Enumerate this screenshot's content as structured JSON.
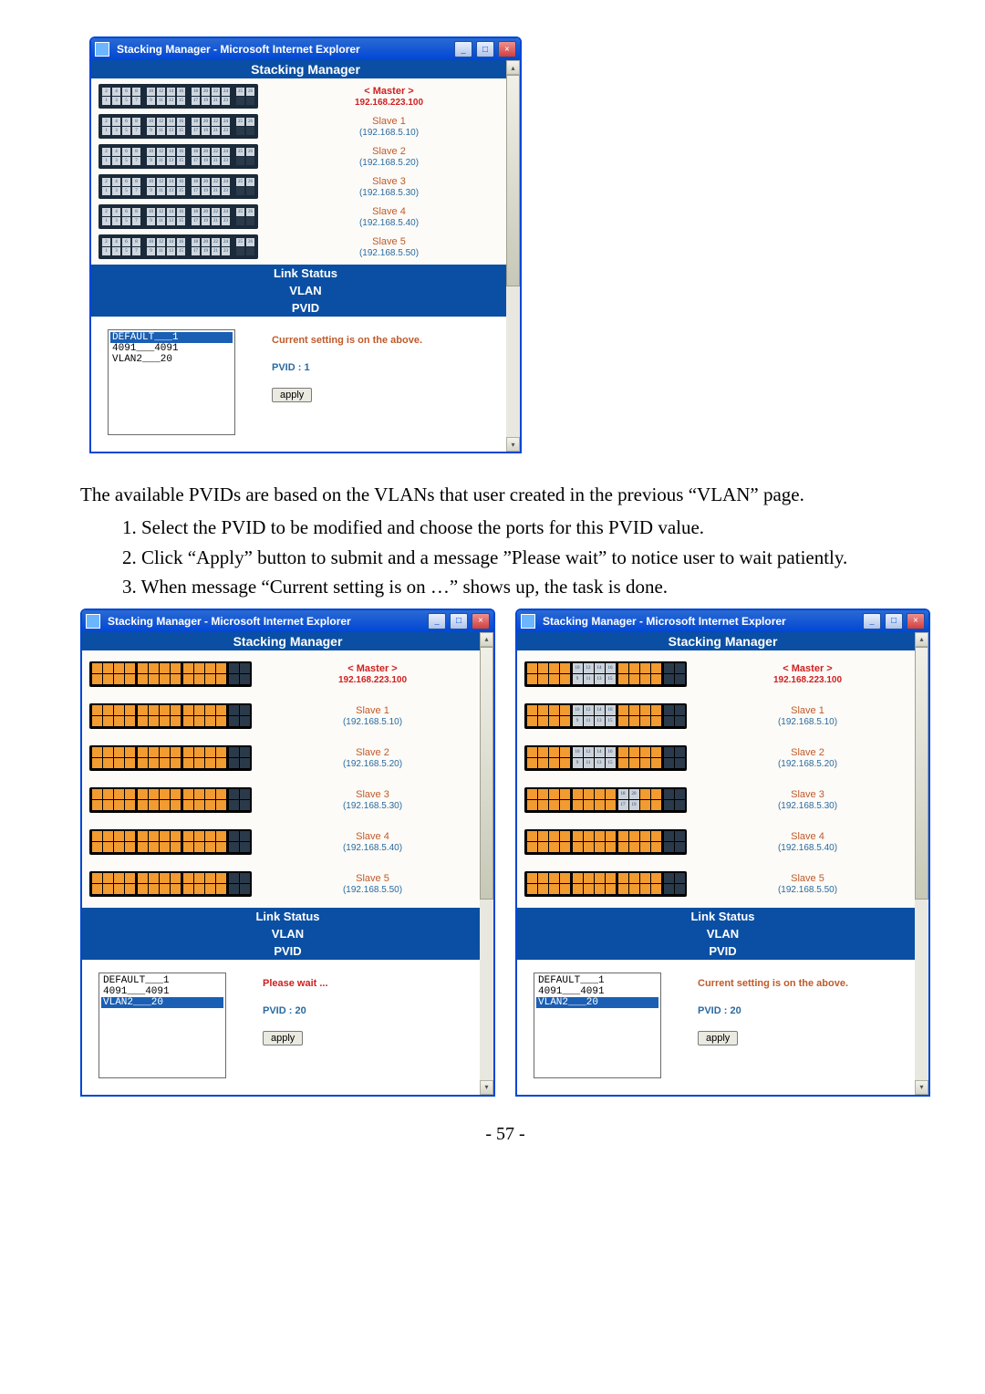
{
  "window_title": "Stacking Manager - Microsoft Internet Explorer",
  "headers": {
    "stacking": "Stacking Manager",
    "link": "Link Status",
    "vlan": "VLAN",
    "pvid": "PVID"
  },
  "switches": [
    {
      "name": "< Master >",
      "ip": "192.168.223.100",
      "master": true
    },
    {
      "name": "Slave 1",
      "ip": "(192.168.5.10)",
      "master": false
    },
    {
      "name": "Slave 2",
      "ip": "(192.168.5.20)",
      "master": false
    },
    {
      "name": "Slave 3",
      "ip": "(192.168.5.30)",
      "master": false
    },
    {
      "name": "Slave 4",
      "ip": "(192.168.5.40)",
      "master": false
    },
    {
      "name": "Slave 5",
      "ip": "(192.168.5.50)",
      "master": false
    }
  ],
  "vlan_list": {
    "items": [
      {
        "label": "DEFAULT___1",
        "sel": true
      },
      {
        "label": "4091___4091",
        "sel": false
      },
      {
        "label": "VLAN2___20",
        "sel": false
      }
    ]
  },
  "status": {
    "current": "Current setting is on the above.",
    "wait": "Please wait ..."
  },
  "pvid": {
    "labels": {
      "one": "PVID : 1",
      "twenty": "PVID : 20"
    },
    "apply": "apply"
  },
  "text": {
    "intro": "The available PVIDs are based on the VLANs that user created in the previous “VLAN” page.",
    "s1": "1. Select the PVID to be modified and choose the ports for this PVID value.",
    "s2": "2. Click “Apply” button to submit and a message ”Please wait” to notice user to wait patiently.",
    "s3": "3. When message “Current setting is on …” shows up, the task is done."
  },
  "bottom_left": {
    "vlan_list": [
      {
        "label": "DEFAULT___1",
        "sel": false
      },
      {
        "label": "4091___4091",
        "sel": false
      },
      {
        "label": "VLAN2___20",
        "sel": true
      }
    ],
    "status": "Please wait ...",
    "pvid": "PVID : 20"
  },
  "bottom_right": {
    "vlan_list": [
      {
        "label": "DEFAULT___1",
        "sel": false
      },
      {
        "label": "4091___4091",
        "sel": false
      },
      {
        "label": "VLAN2___20",
        "sel": true
      }
    ],
    "status": "Current setting is on the above.",
    "pvid": "PVID : 20"
  },
  "footer": "- 57 -"
}
